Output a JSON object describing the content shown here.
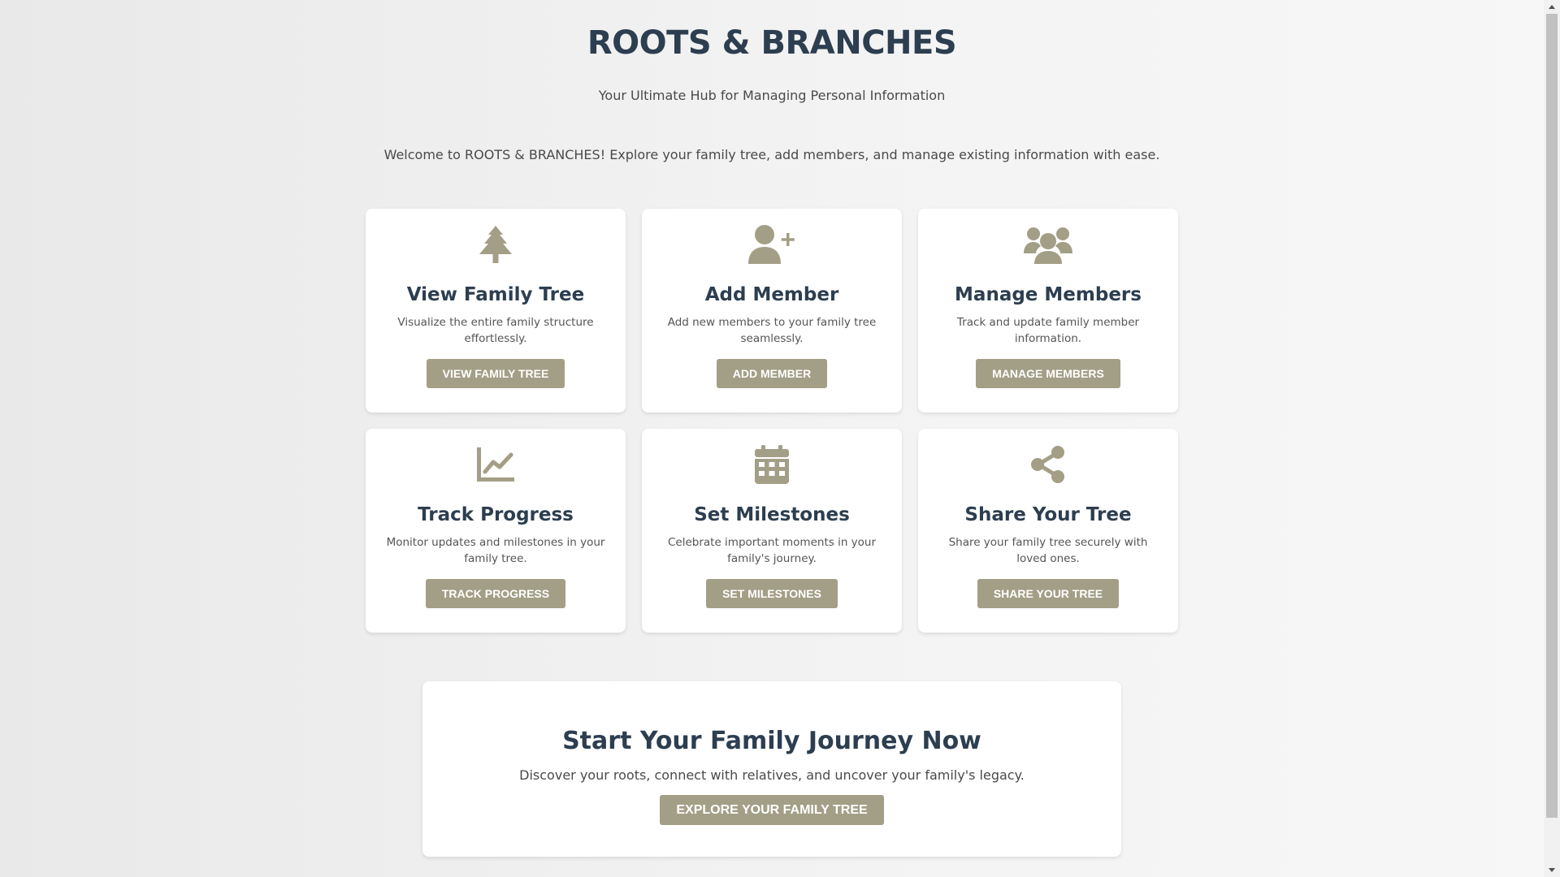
{
  "header": {
    "title": "ROOTS & BRANCHES",
    "subtitle": "Your Ultimate Hub for Managing Personal Information",
    "welcome": "Welcome to ROOTS & BRANCHES! Explore your family tree, add members, and manage existing information with ease."
  },
  "colors": {
    "accent": "#a39e86",
    "heading": "#2c3e50",
    "card_bg": "#ffffff"
  },
  "features": [
    {
      "icon": "tree-icon",
      "title": "View Family Tree",
      "description": "Visualize the entire family structure effortlessly.",
      "button": "VIEW FAMILY TREE"
    },
    {
      "icon": "user-plus-icon",
      "title": "Add Member",
      "description": "Add new members to your family tree seamlessly.",
      "button": "ADD MEMBER"
    },
    {
      "icon": "users-icon",
      "title": "Manage Members",
      "description": "Track and update family member information.",
      "button": "MANAGE MEMBERS"
    },
    {
      "icon": "chart-line-icon",
      "title": "Track Progress",
      "description": "Monitor updates and milestones in your family tree.",
      "button": "TRACK PROGRESS"
    },
    {
      "icon": "calendar-icon",
      "title": "Set Milestones",
      "description": "Celebrate important moments in your family's journey.",
      "button": "SET MILESTONES"
    },
    {
      "icon": "share-icon",
      "title": "Share Your Tree",
      "description": "Share your family tree securely with loved ones.",
      "button": "SHARE YOUR TREE"
    }
  ],
  "cta": {
    "title": "Start Your Family Journey Now",
    "text": "Discover your roots, connect with relatives, and uncover your family's legacy.",
    "button": "EXPLORE YOUR FAMILY TREE"
  }
}
